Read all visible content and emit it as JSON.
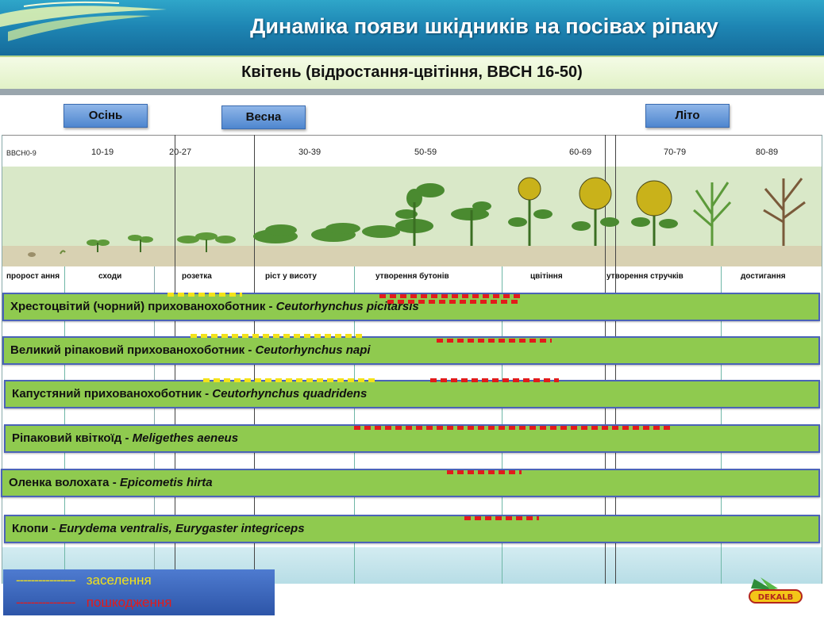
{
  "title": "Динаміка появи шкідників на посівах ріпаку",
  "subtitle": "Квітень (відростання-цвітіння, ВВСН 16-50)",
  "seasons": [
    "Осінь",
    "Весна",
    "Літо"
  ],
  "bbch_labels": [
    "ВВСН0-9",
    "10-19",
    "20-27",
    "30-39",
    "50-59",
    "60-69",
    "70-79",
    "80-89"
  ],
  "stages": [
    "пророст ання",
    "сходи",
    "розетка",
    "ріст у висоту",
    "утворення бутонів",
    "цвітіння",
    "утворення стручків",
    "достигання"
  ],
  "pests": [
    {
      "name": "Хрестоцвітий (чорний) прихованохоботник - ",
      "latin": "Ceutorhynchus picitarsis"
    },
    {
      "name": "Великий ріпаковий прихованохоботник - ",
      "latin": "Ceutorhynchus napi"
    },
    {
      "name": "Капустяний  прихованохоботник - ",
      "latin": "Ceutorhynchus quadridens"
    },
    {
      "name": "Ріпаковий квіткоїд - ",
      "latin": "Meligethes aeneus"
    },
    {
      "name": "Оленка волохата - ",
      "latin": "Epicometis hirta"
    },
    {
      "name": "Клопи - ",
      "latin": "Eurydema ventralis, Eurygaster integriceps"
    }
  ],
  "legend": {
    "settlement_line": "----------------",
    "settlement_label": "заселення",
    "damage_line": "----------------",
    "damage_label": "пошкодження"
  },
  "logo_text": "DEKALB",
  "colors": {
    "header_blue": "#1e86b4",
    "bar_green": "#8fca4f",
    "bar_border": "#4a63b8",
    "settlement_yellow": "#f3e21a",
    "damage_red": "#e21b1b"
  }
}
